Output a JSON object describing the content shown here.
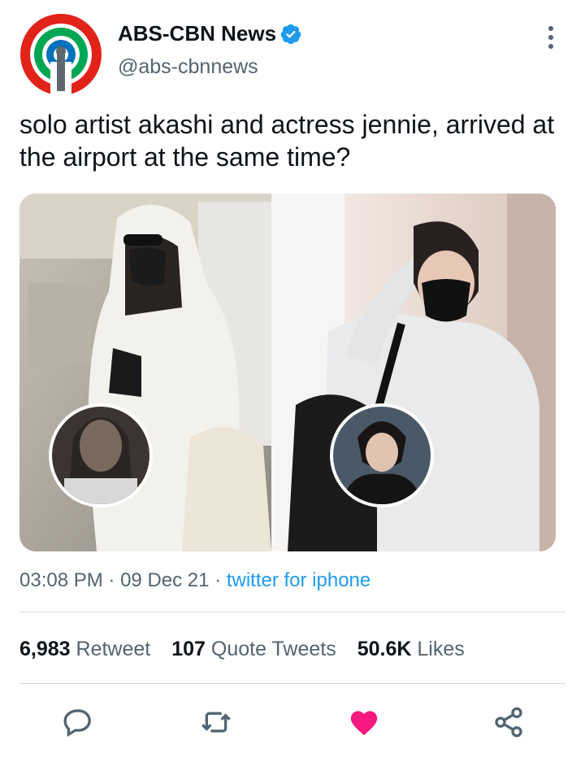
{
  "account": {
    "name": "ABS-CBN News",
    "handle": "@abs-cbnnews",
    "verified": true,
    "logo_colors": [
      "#e2231a",
      "#00a651",
      "#0072bc"
    ]
  },
  "tweet": {
    "text": "solo artist akashi and actress jennie, arrived at the airport at the same time?",
    "time": "03:08 PM",
    "separator": "·",
    "date": "09 Dec 21",
    "source": "twitter for iphone"
  },
  "media": {
    "left_photo": "airport-photo-woman-hoodie",
    "right_photo": "airport-photo-man-mask"
  },
  "stats": {
    "retweets_count": "6,983",
    "retweets_label": "Retweet",
    "quotes_count": "107",
    "quotes_label": "Quote Tweets",
    "likes_count": "50.6K",
    "likes_label": "Likes"
  },
  "actions": {
    "reply_icon": "reply-icon",
    "retweet_icon": "retweet-icon",
    "like_icon": "heart-icon",
    "share_icon": "share-icon",
    "like_color": "#f91880",
    "icon_color": "#536471"
  }
}
